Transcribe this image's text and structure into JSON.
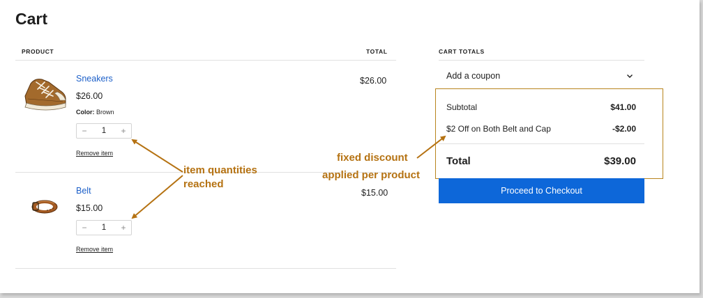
{
  "page": {
    "title": "Cart"
  },
  "table": {
    "col_product": "PRODUCT",
    "col_total": "TOTAL"
  },
  "items": [
    {
      "name": "Sneakers",
      "price": "$26.00",
      "meta_label": "Color:",
      "meta_value": "Brown",
      "qty": "1",
      "minus": "−",
      "plus": "+",
      "remove": "Remove item",
      "line_total": "$26.00",
      "icon": "sneaker-image"
    },
    {
      "name": "Belt",
      "price": "$15.00",
      "qty": "1",
      "minus": "−",
      "plus": "+",
      "remove": "Remove item",
      "line_total": "$15.00",
      "icon": "belt-image"
    }
  ],
  "totals": {
    "header": "CART TOTALS",
    "coupon_label": "Add a coupon",
    "subtotal_label": "Subtotal",
    "subtotal_value": "$41.00",
    "discount_label": "$2 Off on Both Belt and Cap",
    "discount_value": "-$2.00",
    "total_label": "Total",
    "total_value": "$39.00",
    "checkout_label": "Proceed to Checkout"
  },
  "annotations": {
    "qty_note_line1": "item quantities",
    "qty_note_line2": "reached",
    "discount_note_line1": "fixed discount",
    "discount_note_line2": "applied per product"
  },
  "colors": {
    "link": "#1d60c9",
    "button": "#0d67d9",
    "annotation": "#b57212",
    "highlight_border": "#b8841c"
  }
}
